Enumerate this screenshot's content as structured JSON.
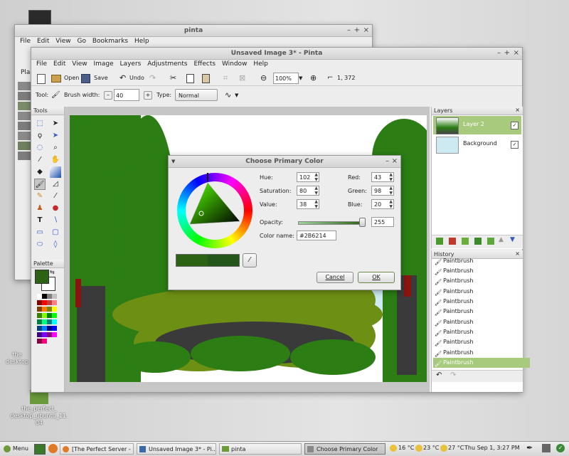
{
  "back_window": {
    "title": "pinta",
    "menu": [
      "File",
      "Edit",
      "View",
      "Go",
      "Bookmarks",
      "Help"
    ],
    "places_label": "Plac",
    "controls": [
      "–",
      "+",
      "×"
    ]
  },
  "pinta": {
    "title": "Unsaved Image 3* - Pinta",
    "controls": [
      "–",
      "+",
      "×"
    ],
    "menu": [
      "File",
      "Edit",
      "View",
      "Image",
      "Layers",
      "Adjustments",
      "Effects",
      "Window",
      "Help"
    ],
    "toolbar": {
      "open_label": "Open",
      "save_label": "Save",
      "undo_label": "Undo",
      "zoom_value": "100%",
      "cursor_pos": "1, 372"
    },
    "toolopts": {
      "tool_label": "Tool:",
      "brush_width_label": "Brush width:",
      "brush_width_value": "40",
      "type_label": "Type:",
      "type_value": "Normal"
    },
    "tools_title": "Tools",
    "palette_title": "Palette",
    "layers": {
      "title": "Layers",
      "items": [
        {
          "name": "Layer 2"
        },
        {
          "name": "Background"
        }
      ]
    },
    "history": {
      "title": "History",
      "items": [
        "Paintbrush",
        "Paintbrush",
        "Paintbrush",
        "Paintbrush",
        "Paintbrush",
        "Paintbrush",
        "Paintbrush",
        "Paintbrush",
        "Paintbrush",
        "Paintbrush",
        "Paintbrush"
      ]
    }
  },
  "dialog": {
    "title": "Choose Primary Color",
    "hue_label": "Hue:",
    "hue_value": "102",
    "saturation_label": "Saturation:",
    "saturation_value": "80",
    "value_label": "Value:",
    "value_value": "38",
    "red_label": "Red:",
    "red_value": "43",
    "green_label": "Green:",
    "green_value": "98",
    "blue_label": "Blue:",
    "blue_value": "20",
    "opacity_label": "Opacity:",
    "opacity_value": "255",
    "color_name_label": "Color name:",
    "color_name_value": "#2B6214",
    "cancel_label": "Cancel",
    "ok_label": "OK"
  },
  "desktop": {
    "icon1_label": "the_perfect_\ndesktop_ubuntu_11.\n04",
    "icon2_label": "the\ndesktop"
  },
  "taskbar": {
    "menu_label": "Menu",
    "tasks": [
      "[The Perfect Server - ...",
      "Unsaved Image 3* - Pi...",
      "pinta",
      "Choose Primary Color"
    ],
    "weather": [
      "16 °C",
      "23 °C",
      "27 °C"
    ],
    "clock": "Thu Sep 1,  3:27 PM"
  },
  "colors": {
    "primary": "#2B6214",
    "secondary": "#ffffff"
  }
}
